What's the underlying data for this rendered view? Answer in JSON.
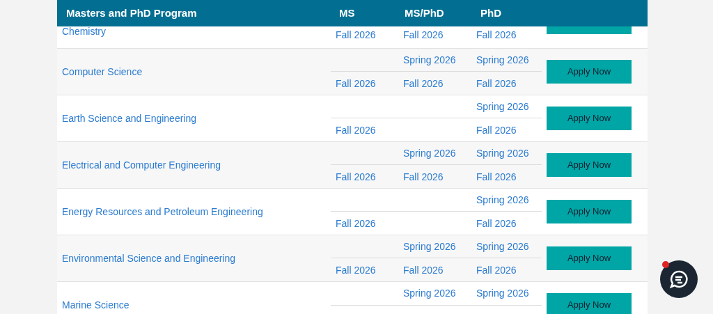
{
  "table": {
    "columns": [
      "Masters and PhD Program",
      "MS",
      "MS/PhD",
      "PhD"
    ],
    "rows": [
      {
        "program": "Chemistry",
        "partial": true,
        "terms": [
          {
            "ms": "Fall 2026",
            "ms_phd": "Fall 2026",
            "phd": "Fall 2026"
          }
        ]
      },
      {
        "program": "Computer Science",
        "button": "Apply Now",
        "terms": [
          {
            "ms_phd": "Spring 2026",
            "phd": "Spring 2026"
          },
          {
            "ms": "Fall 2026",
            "ms_phd": "Fall 2026",
            "phd": "Fall 2026"
          }
        ]
      },
      {
        "program": "Earth Science and Engineering",
        "button": "Apply Now",
        "terms": [
          {
            "phd": "Spring 2026"
          },
          {
            "ms": "Fall 2026",
            "phd": "Fall 2026"
          }
        ]
      },
      {
        "program": "Electrical and Computer Engineering",
        "button": "Apply Now",
        "terms": [
          {
            "ms_phd": "Spring 2026",
            "phd": "Spring 2026"
          },
          {
            "ms": "Fall 2026",
            "ms_phd": "Fall 2026",
            "phd": "Fall 2026"
          }
        ]
      },
      {
        "program": "Energy Resources and Petroleum Engineering",
        "button": "Apply Now",
        "terms": [
          {
            "phd": "Spring 2026"
          },
          {
            "ms": "Fall 2026",
            "phd": "Fall 2026"
          }
        ]
      },
      {
        "program": "Environmental Science and Engineering",
        "button": "Apply Now",
        "terms": [
          {
            "ms_phd": "Spring 2026",
            "phd": "Spring 2026"
          },
          {
            "ms": "Fall 2026",
            "ms_phd": "Fall 2026",
            "phd": "Fall 2026"
          }
        ]
      },
      {
        "program": "Marine Science",
        "button": "Apply Now",
        "terms": [
          {
            "ms_phd": "Spring 2026",
            "phd": "Spring 2026"
          }
        ]
      }
    ]
  },
  "chat_widget": {
    "unread": true
  }
}
